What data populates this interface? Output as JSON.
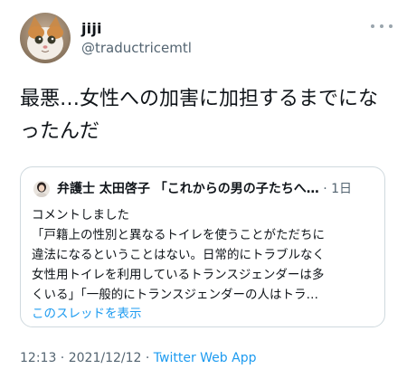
{
  "author": {
    "display_name": "jiji",
    "handle": "@traductricemtl",
    "avatar_icon": "cat-avatar-icon"
  },
  "more_icon": "more-dots-icon",
  "tweet": {
    "lines": [
      "最悪…女性への加害に加担するまでにな",
      "ったんだ"
    ]
  },
  "quote": {
    "author": "弁護士 太田啓子 「これからの男の子たちへ…",
    "separator": "·",
    "date": "1日",
    "avatar_icon": "woman-avatar-icon",
    "lines": [
      "コメントしました",
      "「戸籍上の性別と異なるトイレを使うことがただちに",
      "違法になるということはない。日常的にトラブルなく",
      "女性用トイレを利用しているトランスジェンダーは多",
      "くいる」「一般的にトランスジェンダーの人はトラ…"
    ],
    "show_thread": "このスレッドを表示"
  },
  "meta": {
    "time": "12:13",
    "separator1": " · ",
    "date": "2021/12/12",
    "separator2": " · ",
    "source": "Twitter Web App"
  },
  "colors": {
    "text": "#0f1419",
    "secondary": "#536471",
    "link": "#1d9bf0",
    "border": "#cfd9de"
  }
}
